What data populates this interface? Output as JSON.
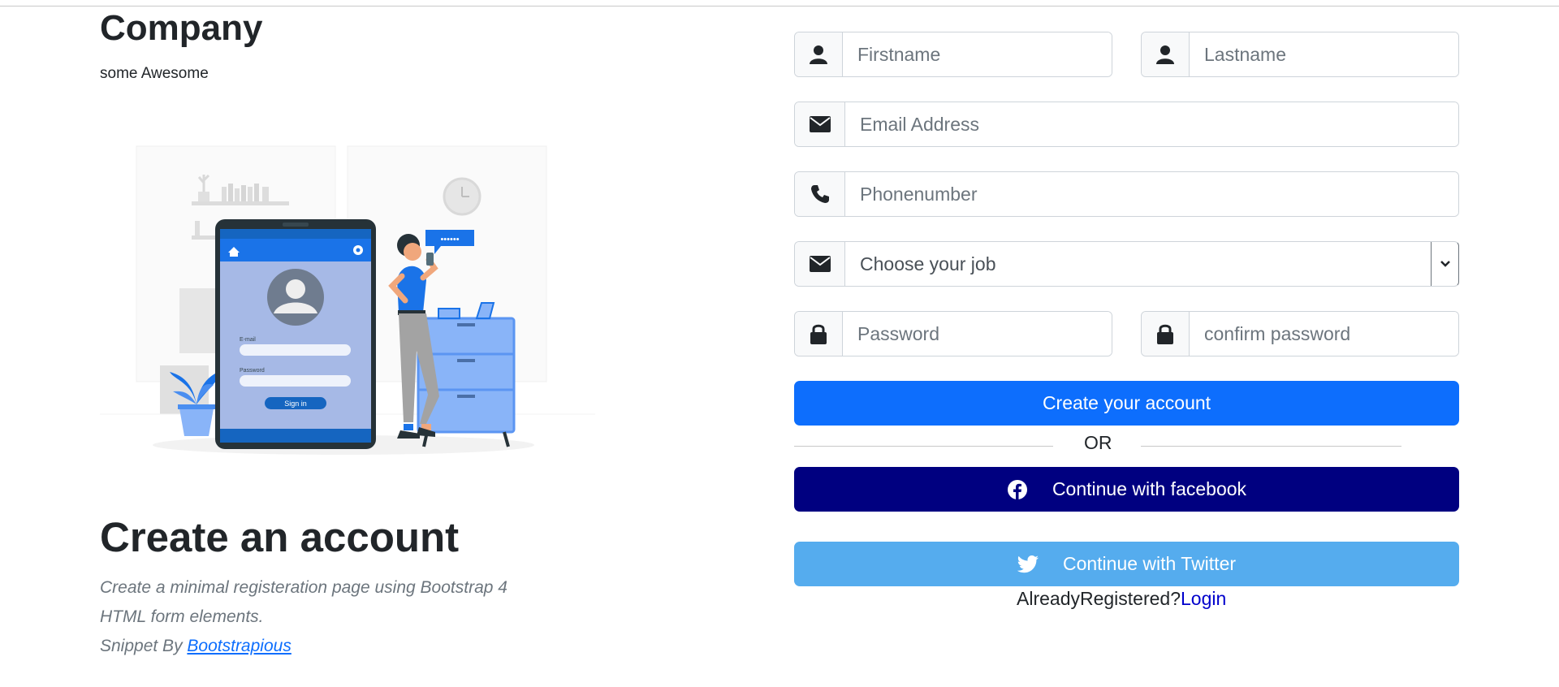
{
  "brand": {
    "name": "Company",
    "tagline": "some Awesome"
  },
  "intro": {
    "heading": "Create an account",
    "description": "Create a minimal registeration page using Bootstrap 4 HTML form elements.",
    "credit_prefix": "Snippet By ",
    "credit_link": "Bootstrapious"
  },
  "illustration": {
    "email_label": "E-mail",
    "password_label": "Password",
    "signin_label": "Sign in",
    "chat_text": "••••••"
  },
  "form": {
    "firstname": {
      "placeholder": "Firstname",
      "icon": "user-icon"
    },
    "lastname": {
      "placeholder": "Lastname",
      "icon": "user-icon"
    },
    "email": {
      "placeholder": "Email Address",
      "icon": "envelope-icon"
    },
    "phone": {
      "placeholder": "Phonenumber",
      "icon": "phone-icon"
    },
    "job": {
      "selected": "Choose your job",
      "icon": "envelope-icon"
    },
    "password": {
      "placeholder": "Password",
      "icon": "lock-icon"
    },
    "confirm": {
      "placeholder": "confirm password",
      "icon": "lock-icon"
    },
    "submit_label": "Create your account",
    "or_label": "OR",
    "facebook_label": "Continue with facebook",
    "twitter_label": "Continue with Twitter",
    "already_label": "AlreadyRegistered?",
    "login_label": "Login"
  },
  "colors": {
    "primary": "#0d6efd",
    "facebook": "#000080",
    "twitter": "#55acee",
    "link": "#0000cc"
  }
}
